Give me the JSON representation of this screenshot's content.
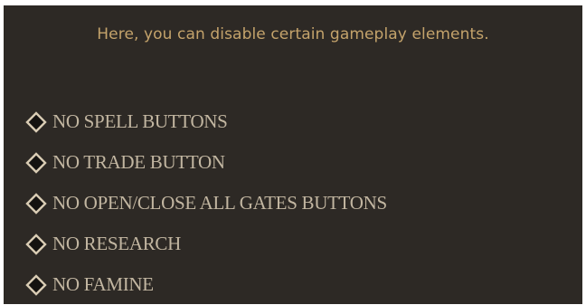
{
  "info": {
    "text": "Here, you can disable certain gameplay elements."
  },
  "colors": {
    "panel_background": "#2d2925",
    "info_text": "#c4a36b",
    "option_text": "#c2b6a1",
    "checkbox_border": "#d9ccb4",
    "checkbox_fill": "#141210"
  },
  "options": [
    {
      "label": "NO SPELL BUTTONS",
      "checked": false,
      "icon": "diamond-checkbox-icon"
    },
    {
      "label": "NO TRADE BUTTON",
      "checked": false,
      "icon": "diamond-checkbox-icon"
    },
    {
      "label": "NO OPEN/CLOSE ALL GATES BUTTONS",
      "checked": false,
      "icon": "diamond-checkbox-icon"
    },
    {
      "label": "NO RESEARCH",
      "checked": false,
      "icon": "diamond-checkbox-icon"
    },
    {
      "label": "NO FAMINE",
      "checked": false,
      "icon": "diamond-checkbox-icon"
    }
  ]
}
